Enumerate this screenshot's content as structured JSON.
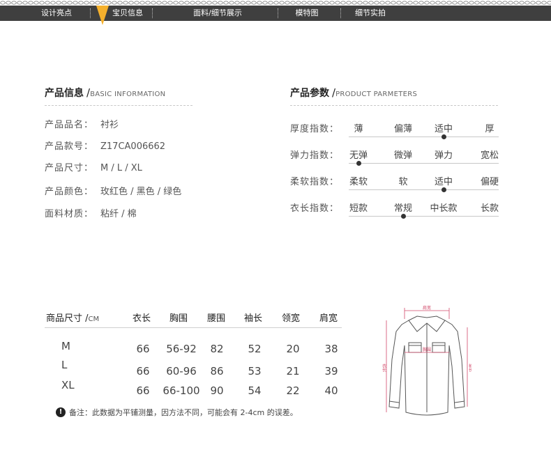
{
  "nav": {
    "items": [
      "设计亮点",
      "宝贝信息",
      "面料/细节展示",
      "模特图",
      "细节实拍"
    ],
    "marker_color": "#f5b02c",
    "bar_color": "#3f3f3f"
  },
  "product_info": {
    "title": "产品信息",
    "title_en": "BASIC INFORMATION",
    "rows": [
      {
        "label": "产品品名：",
        "value": "衬衫"
      },
      {
        "label": "产品款号：",
        "value": "Z17CA006662"
      },
      {
        "label": "产品尺寸：",
        "value": "M / L / XL"
      },
      {
        "label": "产品颜色：",
        "value": "玫红色 / 黑色 / 绿色"
      },
      {
        "label": "面料材质：",
        "value": "粘纤 / 棉"
      }
    ]
  },
  "product_params": {
    "title": "产品参数",
    "title_en": "PRODUCT PARMETERS",
    "rows": [
      {
        "label": "厚度指数：",
        "options": [
          "薄",
          "偏薄",
          "适中",
          "厚"
        ],
        "selected": 2
      },
      {
        "label": "弹力指数：",
        "options": [
          "无弹",
          "微弹",
          "弹力",
          "宽松"
        ],
        "selected": 0
      },
      {
        "label": "柔软指数：",
        "options": [
          "柔软",
          "软",
          "适中",
          "偏硬"
        ],
        "selected": 2
      },
      {
        "label": "衣长指数：",
        "options": [
          "短款",
          "常规",
          "中长款",
          "长款"
        ],
        "selected": 1
      }
    ]
  },
  "size_table": {
    "title": "商品尺寸",
    "unit": "CM",
    "columns": [
      "衣长",
      "胸围",
      "腰围",
      "袖长",
      "领宽",
      "肩宽"
    ],
    "rows": [
      {
        "size": "M",
        "values": [
          "66",
          "56-92",
          "82",
          "52",
          "20",
          "38"
        ]
      },
      {
        "size": "L",
        "values": [
          "66",
          "60-96",
          "86",
          "53",
          "21",
          "39"
        ]
      },
      {
        "size": "XL",
        "values": [
          "66",
          "66-100",
          "90",
          "54",
          "22",
          "40"
        ]
      }
    ],
    "note": "备注：此数据为平铺测量，因方法不同，可能会有 2-4cm 的误差。",
    "note_icon": "alert-icon"
  },
  "diagram": {
    "labels": {
      "shoulder": "肩宽",
      "chest": "胸围",
      "length": "衣长",
      "sleeve": "袖长"
    },
    "measure_color": "#d24a6a"
  }
}
